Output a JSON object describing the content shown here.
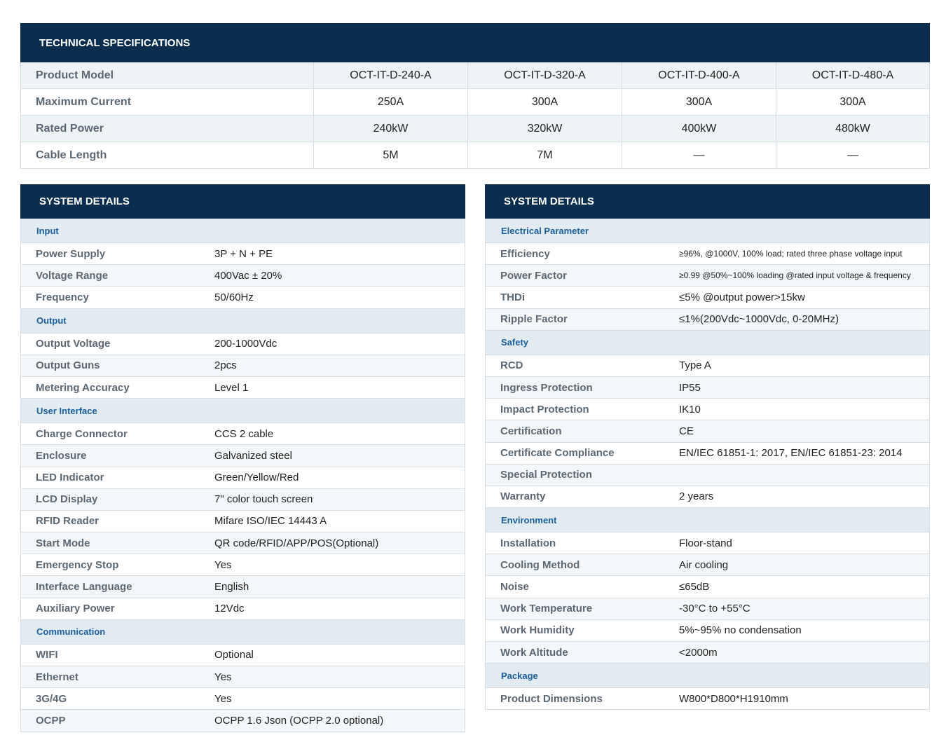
{
  "tech": {
    "title": "TECHNICAL SPECIFICATIONS",
    "rows": [
      {
        "label": "Product Model",
        "values": [
          "OCT-IT-D-240-A",
          "OCT-IT-D-320-A",
          "OCT-IT-D-400-A",
          "OCT-IT-D-480-A"
        ]
      },
      {
        "label": "Maximum Current",
        "values": [
          "250A",
          "300A",
          "300A",
          "300A"
        ]
      },
      {
        "label": "Rated Power",
        "values": [
          "240kW",
          "320kW",
          "400kW",
          "480kW"
        ]
      },
      {
        "label": "Cable Length",
        "values": [
          "5M",
          "7M",
          "—",
          "—"
        ]
      }
    ]
  },
  "left": {
    "title": "SYSTEM DETAILS",
    "sections": [
      {
        "name": "Input",
        "rows": [
          {
            "label": "Power Supply",
            "value": "3P + N + PE"
          },
          {
            "label": "Voltage Range",
            "value": "400Vac ± 20%"
          },
          {
            "label": "Frequency",
            "value": "50/60Hz"
          }
        ]
      },
      {
        "name": "Output",
        "rows": [
          {
            "label": "Output Voltage",
            "value": "200-1000Vdc"
          },
          {
            "label": "Output Guns",
            "value": "2pcs"
          },
          {
            "label": "Metering Accuracy",
            "value": "Level 1"
          }
        ]
      },
      {
        "name": "User Interface",
        "rows": [
          {
            "label": "Charge Connector",
            "value": "CCS 2 cable"
          },
          {
            "label": "Enclosure",
            "value": "Galvanized steel"
          },
          {
            "label": "LED Indicator",
            "value": "Green/Yellow/Red"
          },
          {
            "label": "LCD Display",
            "value": "7\" color touch screen"
          },
          {
            "label": "RFID Reader",
            "value": "Mifare ISO/IEC 14443 A"
          },
          {
            "label": "Start Mode",
            "value": "QR code/RFID/APP/POS(Optional)"
          },
          {
            "label": "Emergency Stop",
            "value": "Yes"
          },
          {
            "label": "Interface Language",
            "value": "English"
          },
          {
            "label": "Auxiliary Power",
            "value": "12Vdc"
          }
        ]
      },
      {
        "name": "Communication",
        "rows": [
          {
            "label": "WIFI",
            "value": "Optional"
          },
          {
            "label": "Ethernet",
            "value": "Yes"
          },
          {
            "label": "3G/4G",
            "value": "Yes"
          },
          {
            "label": "OCPP",
            "value": "OCPP 1.6 Json (OCPP 2.0 optional)"
          }
        ]
      }
    ]
  },
  "right": {
    "title": "SYSTEM DETAILS",
    "sections": [
      {
        "name": "Electrical Parameter",
        "rows": [
          {
            "label": "Efficiency",
            "value": "≥96%, @1000V, 100% load; rated three phase voltage input",
            "small": true
          },
          {
            "label": "Power Factor",
            "value": "≥0.99 @50%~100% loading @rated input voltage & frequency",
            "small": true
          },
          {
            "label": "THDi",
            "value": "≤5% @output power>15kw"
          },
          {
            "label": "Ripple Factor",
            "value": "≤1%(200Vdc~1000Vdc, 0-20MHz)"
          }
        ]
      },
      {
        "name": "Safety",
        "rows": [
          {
            "label": "RCD",
            "value": "Type A"
          },
          {
            "label": "Ingress Protection",
            "value": "IP55"
          },
          {
            "label": "Impact Protection",
            "value": "IK10"
          },
          {
            "label": "Certification",
            "value": "CE"
          },
          {
            "label": "Certificate Compliance",
            "value": "EN/IEC 61851-1: 2017, EN/IEC 61851-23: 2014"
          },
          {
            "label": "Special Protection",
            "value": ""
          },
          {
            "label": "Warranty",
            "value": "2 years"
          }
        ]
      },
      {
        "name": "Environment",
        "rows": [
          {
            "label": "Installation",
            "value": "Floor-stand"
          },
          {
            "label": "Cooling Method",
            "value": "Air cooling"
          },
          {
            "label": "Noise",
            "value": "≤65dB"
          },
          {
            "label": "Work Temperature",
            "value": "-30°C to +55°C"
          },
          {
            "label": "Work Humidity",
            "value": "5%~95% no condensation"
          },
          {
            "label": "Work Altitude",
            "value": "<2000m"
          }
        ]
      },
      {
        "name": "Package",
        "rows": [
          {
            "label": "Product Dimensions",
            "value": "W800*D800*H1910mm"
          }
        ]
      }
    ]
  }
}
